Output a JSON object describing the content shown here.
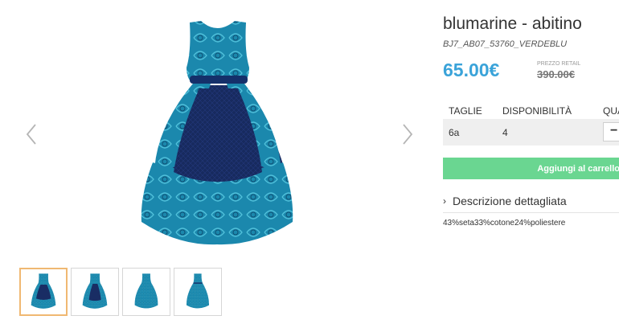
{
  "product": {
    "title": "blumarine - abitino",
    "sku": "BJ7_AB07_53760_VERDEBLU",
    "price": "65.00€",
    "retail_label": "PREZZO RETAIL",
    "retail_price": "390.00€"
  },
  "sizes_table": {
    "headers": [
      "TAGLIE",
      "DISPONIBILITÀ",
      "QUA"
    ],
    "rows": [
      {
        "size": "6a",
        "availability": "4",
        "quantity_control": "−"
      }
    ]
  },
  "cart_button_label": "Aggiungi al carrello",
  "description": {
    "toggle_icon": "›",
    "label": "Descrizione dettagliata",
    "composition": "43%seta33%cotone24%poliestere"
  },
  "gallery": {
    "thumbnail_count": 4,
    "active_index": 0,
    "dress_colors": {
      "fabric": "#1d8eb2",
      "dark": "#14285a",
      "highlight": "#5fd0e6"
    }
  }
}
